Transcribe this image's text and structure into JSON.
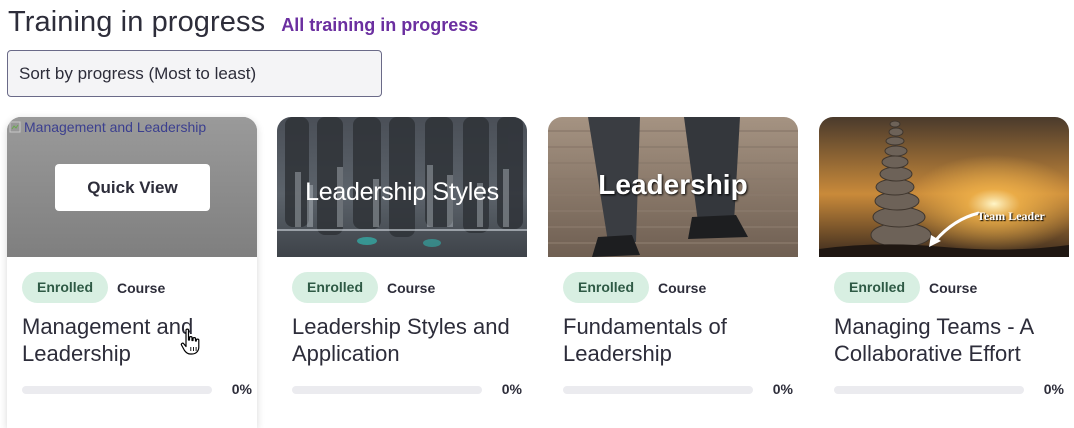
{
  "header": {
    "title": "Training in progress",
    "all_link": "All training in progress"
  },
  "sort": {
    "value": "Sort by progress (Most to least)"
  },
  "cards": [
    {
      "image_alt": "Management and Leadership",
      "quick_view": "Quick View",
      "badge": "Enrolled",
      "type": "Course",
      "title": "Management and Leadership",
      "progress": 0,
      "progress_label": "0%"
    },
    {
      "image_text": "Leadership Styles",
      "badge": "Enrolled",
      "type": "Course",
      "title": "Leadership Styles and Application",
      "progress": 0,
      "progress_label": "0%"
    },
    {
      "image_text": "Leadership",
      "badge": "Enrolled",
      "type": "Course",
      "title": "Fundamentals of Leadership",
      "progress": 0,
      "progress_label": "0%"
    },
    {
      "image_text": "Team Leader",
      "badge": "Enrolled",
      "type": "Course",
      "title": "Managing Teams - A Collaborative Effort",
      "progress": 0,
      "progress_label": "0%"
    }
  ],
  "colors": {
    "accent": "#6b2fa0",
    "badge_bg": "#d8efe2",
    "badge_text": "#2e5a45"
  },
  "icons": [
    "broken-image-icon",
    "hand-pointer-cursor-icon",
    "arrow-icon"
  ]
}
